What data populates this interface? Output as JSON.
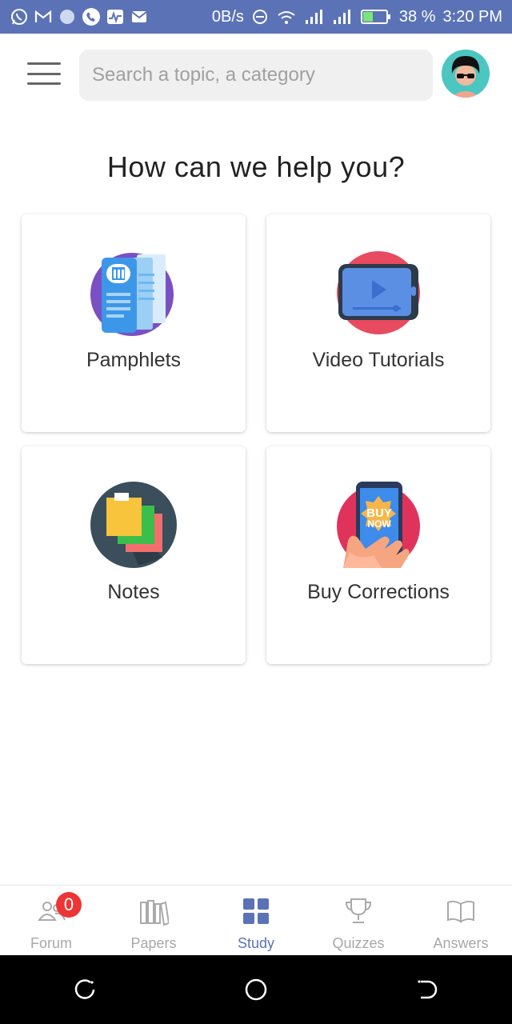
{
  "status_bar": {
    "left_icons": [
      "whatsapp-icon",
      "gmail-icon",
      "circle-app-icon",
      "phone-icon",
      "activity-icon",
      "message-icon"
    ],
    "speed": "0B/s",
    "battery": "38 %",
    "time": "3:20 PM",
    "background": "#5b73b6"
  },
  "header": {
    "search_placeholder": "Search a topic, a category",
    "avatar": "avatar-icon"
  },
  "main": {
    "heading": "How can we help you?",
    "cards": [
      {
        "label": "Pamphlets",
        "icon": "pamphlets-icon"
      },
      {
        "label": "Video Tutorials",
        "icon": "video-tutorials-icon"
      },
      {
        "label": "Notes",
        "icon": "notes-icon"
      },
      {
        "label": "Buy Corrections",
        "icon": "buy-corrections-icon",
        "icon_text": "BUY NOW"
      }
    ]
  },
  "bottom_nav": {
    "items": [
      {
        "label": "Forum",
        "icon": "forum-icon",
        "badge": "0"
      },
      {
        "label": "Papers",
        "icon": "papers-icon"
      },
      {
        "label": "Study",
        "icon": "study-icon",
        "active": true
      },
      {
        "label": "Quizzes",
        "icon": "trophy-icon"
      },
      {
        "label": "Answers",
        "icon": "book-icon"
      }
    ],
    "active_color": "#5b73b6",
    "badge_color": "#ee3535"
  },
  "system_nav": [
    "recents-icon",
    "home-icon",
    "back-icon"
  ]
}
